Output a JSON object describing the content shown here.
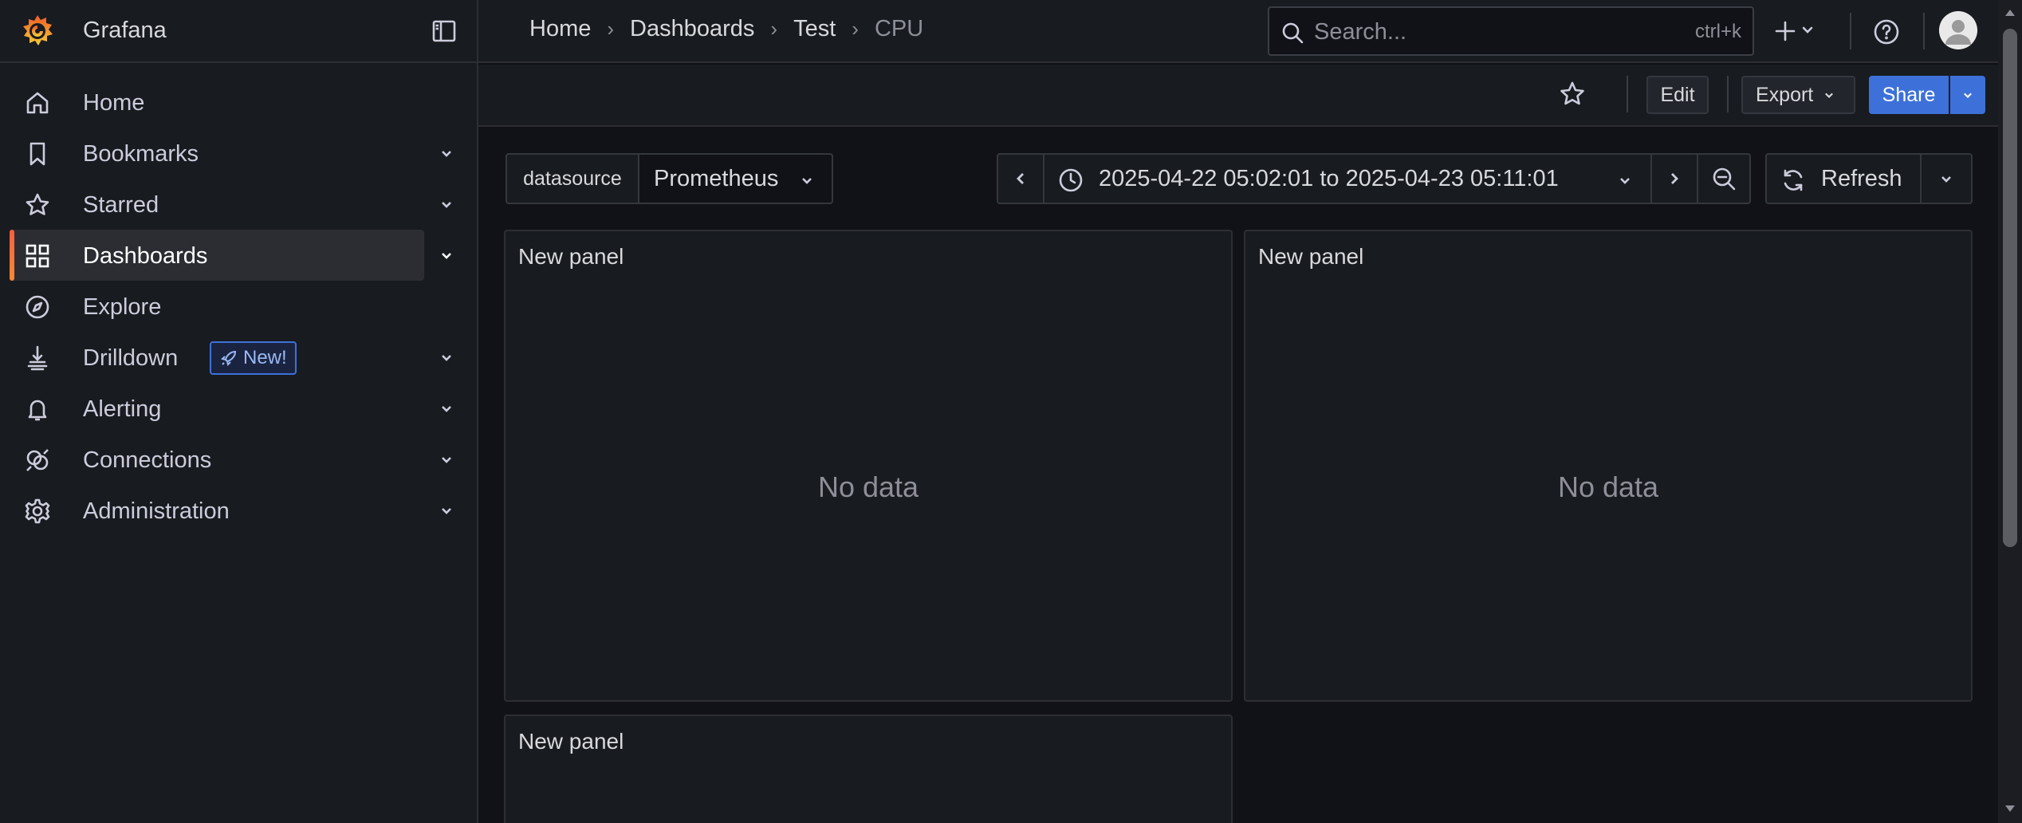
{
  "app": {
    "name": "Grafana"
  },
  "sidebar": {
    "items": [
      {
        "label": "Home",
        "icon": "home-icon",
        "expandable": false
      },
      {
        "label": "Bookmarks",
        "icon": "bookmark-icon",
        "expandable": true
      },
      {
        "label": "Starred",
        "icon": "star-icon",
        "expandable": true
      },
      {
        "label": "Dashboards",
        "icon": "apps-icon",
        "expandable": true,
        "active": true
      },
      {
        "label": "Explore",
        "icon": "compass-icon",
        "expandable": false
      },
      {
        "label": "Drilldown",
        "icon": "drilldown-icon",
        "expandable": true,
        "badge": "New!"
      },
      {
        "label": "Alerting",
        "icon": "bell-icon",
        "expandable": true
      },
      {
        "label": "Connections",
        "icon": "connections-icon",
        "expandable": true
      },
      {
        "label": "Administration",
        "icon": "cog-icon",
        "expandable": true
      }
    ]
  },
  "breadcrumb": [
    "Home",
    "Dashboards",
    "Test",
    "CPU"
  ],
  "search": {
    "placeholder": "Search...",
    "shortcut": "ctrl+k"
  },
  "toolbar": {
    "edit_label": "Edit",
    "export_label": "Export",
    "share_label": "Share"
  },
  "variables": {
    "label": "datasource",
    "value": "Prometheus"
  },
  "time_range": {
    "from": "2025-04-22 05:02:01",
    "separator": "to",
    "to": "2025-04-23 05:11:01"
  },
  "refresh": {
    "label": "Refresh"
  },
  "panels": [
    {
      "title": "New panel",
      "message": "No data"
    },
    {
      "title": "New panel",
      "message": "No data"
    },
    {
      "title": "New panel"
    }
  ],
  "colors": {
    "background": "#111217",
    "surface": "#181b1f",
    "primary": "#3d71d9",
    "accent_gradient": [
      "#f55f3e",
      "#ff8833"
    ],
    "text": "#ccccdc",
    "muted_text": "#8e8e99"
  }
}
